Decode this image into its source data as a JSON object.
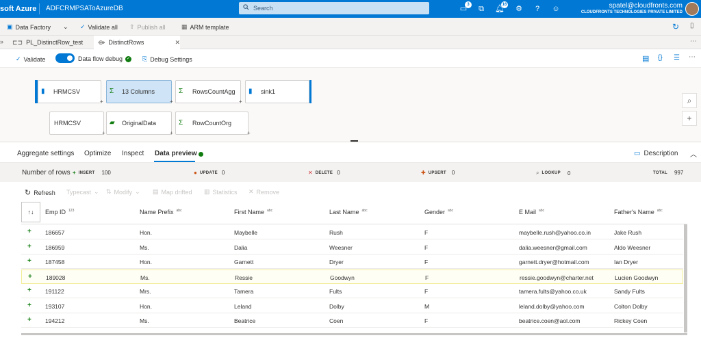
{
  "topbar": {
    "brand": "soft Azure",
    "factory": "ADFCRMPSAToAzureDB",
    "search_placeholder": "Search",
    "notif1_count": "3",
    "notif2_count": "16",
    "email": "spatel@cloudfronts.com",
    "org": "CLOUDFRONTS TECHNOLOGIES PRIVATE LIMITED"
  },
  "cmdbar": {
    "data_factory": "Data Factory",
    "validate_all": "Validate all",
    "publish_all": "Publish all",
    "arm_template": "ARM template"
  },
  "tabs": [
    {
      "label": "PL_DistinctRow_test"
    },
    {
      "label": "DistinctRows"
    }
  ],
  "toolbar2": {
    "validate": "Validate",
    "dataflow_debug": "Data flow debug",
    "debug_settings": "Debug Settings"
  },
  "nodes": {
    "source1": "HRMCSV",
    "agg1": "13 Columns",
    "agg2": "RowsCountAgg",
    "sink": "sink1",
    "source2": "HRMCSV",
    "original": "OriginalData",
    "agg3": "RowCountOrg"
  },
  "panel": {
    "tabs": [
      "Aggregate settings",
      "Optimize",
      "Inspect",
      "Data preview"
    ],
    "description": "Description"
  },
  "stats": {
    "number_of_rows": "Number of rows",
    "insert_label": "INSERT",
    "insert_val": "100",
    "update_label": "UPDATE",
    "update_val": "0",
    "delete_label": "DELETE",
    "delete_val": "0",
    "upsert_label": "UPSERT",
    "upsert_val": "0",
    "lookup_label": "LOOKUP",
    "lookup_val": "0",
    "total_label": "TOTAL",
    "total_val": "997"
  },
  "actions": {
    "refresh": "Refresh",
    "typecast": "Typecast",
    "modify": "Modify",
    "map_drifted": "Map drifted",
    "statistics": "Statistics",
    "remove": "Remove"
  },
  "table": {
    "columns": [
      {
        "label": "Emp ID",
        "type": "123"
      },
      {
        "label": "Name Prefix",
        "type": "abc"
      },
      {
        "label": "First Name",
        "type": "abc"
      },
      {
        "label": "Last Name",
        "type": "abc"
      },
      {
        "label": "Gender",
        "type": "abc"
      },
      {
        "label": "E Mail",
        "type": "abc"
      },
      {
        "label": "Father's Name",
        "type": "abc"
      }
    ],
    "rows": [
      [
        "186657",
        "Hon.",
        "Maybelle",
        "Rush",
        "F",
        "maybelle.rush@yahoo.co.in",
        "Jake Rush"
      ],
      [
        "186959",
        "Ms.",
        "Dalia",
        "Weesner",
        "F",
        "dalia.weesner@gmail.com",
        "Aldo Weesner"
      ],
      [
        "187458",
        "Hon.",
        "Garnett",
        "Dryer",
        "F",
        "garnett.dryer@hotmail.com",
        "Ian Dryer"
      ],
      [
        "189028",
        "Ms.",
        "Ressie",
        "Goodwyn",
        "F",
        "ressie.goodwyn@charter.net",
        "Lucien Goodwyn"
      ],
      [
        "191122",
        "Mrs.",
        "Tamera",
        "Fults",
        "F",
        "tamera.fults@yahoo.co.uk",
        "Sandy Fults"
      ],
      [
        "193107",
        "Hon.",
        "Leland",
        "Dolby",
        "M",
        "leland.dolby@yahoo.com",
        "Colton Dolby"
      ],
      [
        "194212",
        "Ms.",
        "Beatrice",
        "Coen",
        "F",
        "beatrice.coen@aol.com",
        "Rickey Coen"
      ]
    ],
    "insert_marker": "+"
  },
  "colors": {
    "accent": "#0078d4",
    "insert": "#107c10",
    "debug_ok": "#107c10"
  }
}
